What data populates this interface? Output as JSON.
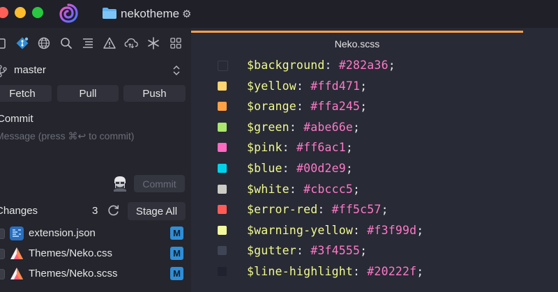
{
  "titlebar": {
    "project_name": "nekotheme"
  },
  "sidebar": {
    "toolbar_icons": [
      "files-icon",
      "git-icon",
      "globe-icon",
      "search-icon",
      "outline-icon",
      "warning-icon",
      "cloud-sync-icon",
      "asterisk-icon",
      "grid-icon"
    ],
    "branch": "master",
    "buttons": {
      "fetch": "Fetch",
      "pull": "Pull",
      "push": "Push"
    },
    "commit": {
      "heading": "Commit",
      "placeholder": "Message (press ⌘↩ to commit)",
      "button": "Commit"
    },
    "changes": {
      "heading": "Changes",
      "count": "3",
      "stage_all": "Stage All",
      "files": [
        {
          "name": "extension.json",
          "status": "M",
          "icon": "json-file-icon"
        },
        {
          "name": "Themes/Neko.css",
          "status": "M",
          "icon": "css-file-icon"
        },
        {
          "name": "Themes/Neko.scss",
          "status": "M",
          "icon": "scss-file-icon"
        }
      ]
    }
  },
  "editor": {
    "tab_title": "Neko.scss",
    "accent_color": "#ffa245",
    "lines": [
      {
        "var": "$background",
        "value": "#282a36",
        "swatch": "#282a36"
      },
      {
        "var": "$yellow",
        "value": "#ffd471",
        "swatch": "#ffd471"
      },
      {
        "var": "$orange",
        "value": "#ffa245",
        "swatch": "#ffa245"
      },
      {
        "var": "$green",
        "value": "#abe66e",
        "swatch": "#abe66e"
      },
      {
        "var": "$pink",
        "value": "#ff6ac1",
        "swatch": "#ff6ac1"
      },
      {
        "var": "$blue",
        "value": "#00d2e9",
        "swatch": "#00d2e9"
      },
      {
        "var": "$white",
        "value": "#cbccc5",
        "swatch": "#cbccc5"
      },
      {
        "var": "$error-red",
        "value": "#ff5c57",
        "swatch": "#ff5c57"
      },
      {
        "var": "$warning-yellow",
        "value": "#f3f99d",
        "swatch": "#f3f99d"
      },
      {
        "var": "$gutter",
        "value": "#3f4555",
        "swatch": "#3f4555"
      },
      {
        "var": "$line-highlight",
        "value": "#20222f",
        "swatch": "#20222f"
      }
    ]
  }
}
